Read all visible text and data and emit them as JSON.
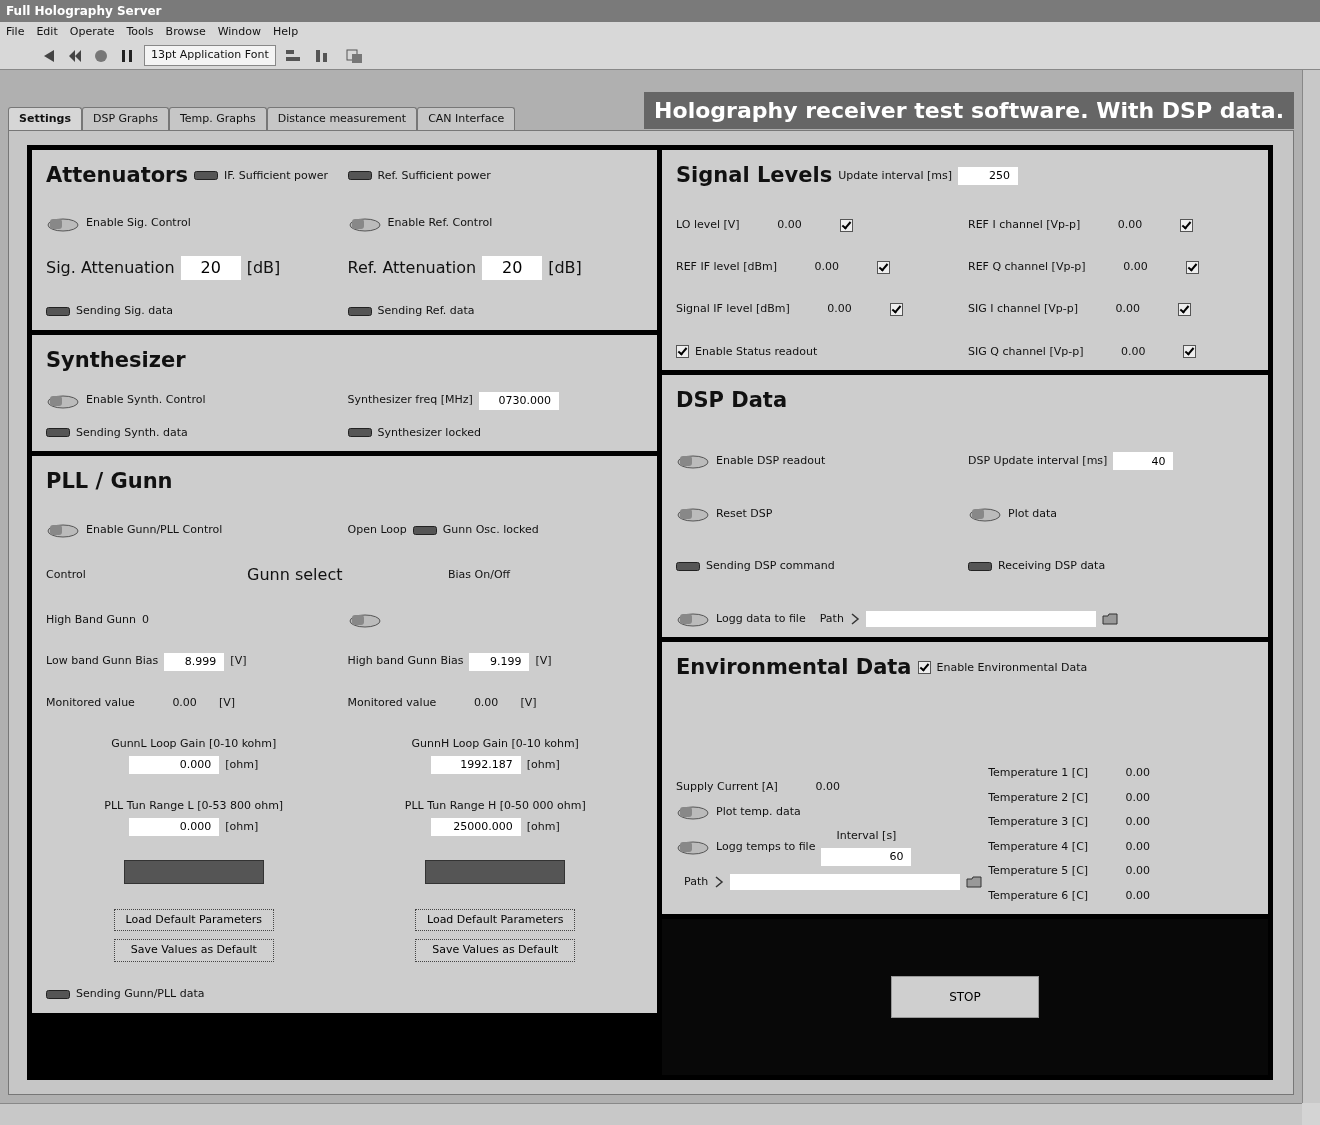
{
  "window": {
    "title": "Full Holography Server"
  },
  "menu": [
    "File",
    "Edit",
    "Operate",
    "Tools",
    "Browse",
    "Window",
    "Help"
  ],
  "toolbar": {
    "font": "13pt Application Font"
  },
  "tabs": [
    {
      "label": "Settings",
      "selected": true
    },
    {
      "label": "DSP Graphs",
      "selected": false
    },
    {
      "label": "Temp. Graphs",
      "selected": false
    },
    {
      "label": "Distance measurement",
      "selected": false
    },
    {
      "label": "CAN Interface",
      "selected": false
    }
  ],
  "banner": "Holography receiver test software. With DSP data.",
  "left_panels": [
    {
      "rows": [
        [
          [
            [
              {
                "kind": "heading",
                "label": "Attenuators"
              },
              {
                "kind": "led",
                "label": "IF. Sufficient power",
                "on": false
              }
            ]
          ],
          [
            [
              {
                "kind": "led",
                "label": "Ref. Sufficient power",
                "on": false
              }
            ]
          ]
        ],
        [
          [
            [
              {
                "kind": "toggle",
                "label": "Enable Sig. Control",
                "on": false
              }
            ]
          ],
          [
            [
              {
                "kind": "toggle",
                "label": "Enable Ref. Control",
                "on": false
              }
            ]
          ]
        ],
        [
          [
            [
              {
                "kind": "bigfield",
                "label": "Sig. Attenuation",
                "value": "20",
                "unit": "[dB]"
              }
            ]
          ],
          [
            [
              {
                "kind": "bigfield",
                "label": "Ref. Attenuation",
                "value": "20",
                "unit": "[dB]"
              }
            ]
          ]
        ],
        [
          [
            [
              {
                "kind": "led",
                "label": "Sending Sig. data",
                "on": false
              }
            ]
          ],
          [
            [
              {
                "kind": "led",
                "label": "Sending Ref. data",
                "on": false
              }
            ]
          ]
        ]
      ]
    },
    {
      "rows": [
        [
          [
            [
              {
                "kind": "heading",
                "label": "Synthesizer"
              }
            ]
          ]
        ],
        [
          [
            [
              {
                "kind": "toggle",
                "label": "Enable Synth. Control",
                "on": false
              }
            ]
          ],
          [
            [
              {
                "kind": "field",
                "label": "Synthesizer freq [MHz]",
                "value": "0730.000"
              }
            ]
          ]
        ],
        [
          [
            [
              {
                "kind": "led",
                "label": "Sending Synth. data",
                "on": false
              }
            ]
          ],
          [
            [
              {
                "kind": "led",
                "label": "Synthesizer locked",
                "on": false
              }
            ]
          ]
        ]
      ]
    },
    {
      "rows": [
        [
          [
            [
              {
                "kind": "heading",
                "label": "PLL / Gunn"
              }
            ]
          ]
        ],
        [
          [
            [
              {
                "kind": "toggle",
                "label": "Enable Gunn/PLL Control",
                "on": false
              }
            ]
          ],
          [
            [
              {
                "kind": "text",
                "label": "Open Loop"
              },
              {
                "kind": "led",
                "label": "Gunn Osc. locked",
                "on": false
              }
            ]
          ]
        ],
        [
          [
            [
              {
                "kind": "text",
                "label": "Control"
              }
            ]
          ],
          [
            [
              {
                "kind": "bigtext",
                "label": "Gunn select"
              }
            ]
          ],
          [
            [
              {
                "kind": "text",
                "label": "Bias On/Off"
              }
            ]
          ]
        ],
        [
          [
            [
              {
                "kind": "text",
                "label": "High Band Gunn"
              },
              {
                "kind": "text",
                "label": "0"
              }
            ]
          ],
          [
            [
              {
                "kind": "toggle",
                "on": false
              }
            ]
          ]
        ],
        [
          [
            [
              {
                "kind": "field",
                "label": "Low band Gunn Bias",
                "value": "8.999",
                "unit": "[V]"
              }
            ]
          ],
          [
            [
              {
                "kind": "field",
                "label": "High band Gunn Bias",
                "value": "9.199",
                "unit": "[V]"
              }
            ]
          ]
        ],
        [
          [
            [
              {
                "kind": "indicator",
                "label": "Monitored value",
                "value": "0.00",
                "unit": "[V]"
              }
            ]
          ],
          [
            [
              {
                "kind": "indicator",
                "label": "Monitored value",
                "value": "0.00",
                "unit": "[V]"
              }
            ]
          ]
        ],
        [
          [
            [
              {
                "kind": "stacked",
                "label": "GunnL Loop Gain [0-10 kohm]",
                "value": "0.000",
                "unit": "[ohm]"
              }
            ]
          ],
          [
            [
              {
                "kind": "stacked",
                "label": "GunnH Loop Gain [0-10 kohm]",
                "value": "1992.187",
                "unit": "[ohm]"
              }
            ]
          ]
        ],
        [
          [
            [
              {
                "kind": "stacked",
                "label": "PLL Tun Range L [0-53 800 ohm]",
                "value": "0.000",
                "unit": "[ohm]"
              }
            ]
          ],
          [
            [
              {
                "kind": "stacked",
                "label": "PLL Tun Range H [0-50 000 ohm]",
                "value": "25000.000",
                "unit": "[ohm]"
              }
            ]
          ]
        ],
        [
          [
            [
              {
                "kind": "bar"
              }
            ]
          ],
          [
            [
              {
                "kind": "bar"
              }
            ]
          ]
        ],
        [
          [
            [
              {
                "kind": "button",
                "label": "Load Default Parameters"
              }
            ],
            [
              {
                "kind": "button",
                "label": "Save Values as Default"
              }
            ]
          ],
          [
            [
              {
                "kind": "button",
                "label": "Load Default Parameters"
              }
            ],
            [
              {
                "kind": "button",
                "label": "Save Values as Default"
              }
            ]
          ]
        ],
        [
          [
            [
              {
                "kind": "led",
                "label": "Sending Gunn/PLL data",
                "on": false
              }
            ]
          ]
        ]
      ]
    }
  ],
  "right_panels": [
    {
      "rows": [
        [
          [
            [
              {
                "kind": "heading",
                "label": "Signal Levels"
              },
              {
                "kind": "field",
                "label": "Update interval [ms]",
                "value": "250"
              }
            ]
          ]
        ],
        [
          [
            [
              {
                "kind": "indcheck",
                "label": "LO level [V]",
                "value": "0.00",
                "checked": true
              }
            ]
          ],
          [
            [
              {
                "kind": "indcheck",
                "label": "REF I channel [Vp-p]",
                "value": "0.00",
                "checked": true
              }
            ]
          ]
        ],
        [
          [
            [
              {
                "kind": "indcheck",
                "label": "REF IF level [dBm]",
                "value": "0.00",
                "checked": true
              }
            ]
          ],
          [
            [
              {
                "kind": "indcheck",
                "label": "REF Q channel [Vp-p]",
                "value": "0.00",
                "checked": true
              }
            ]
          ]
        ],
        [
          [
            [
              {
                "kind": "indcheck",
                "label": "Signal IF level [dBm]",
                "value": "0.00",
                "checked": true
              }
            ]
          ],
          [
            [
              {
                "kind": "indcheck",
                "label": "SIG I channel [Vp-p]",
                "value": "0.00",
                "checked": true
              }
            ]
          ]
        ],
        [
          [
            [
              {
                "kind": "check",
                "label": "Enable Status readout",
                "checked": true
              }
            ]
          ],
          [
            [
              {
                "kind": "indcheck",
                "label": "SIG Q channel [Vp-p]",
                "value": "0.00",
                "checked": true
              }
            ]
          ]
        ]
      ]
    },
    {
      "rows": [
        [
          [
            [
              {
                "kind": "heading",
                "label": "DSP Data"
              }
            ]
          ]
        ],
        [
          [
            [
              {
                "kind": "toggle",
                "label": "Enable DSP readout",
                "on": false
              }
            ]
          ],
          [
            [
              {
                "kind": "field",
                "label": "DSP Update interval [ms]",
                "value": "40"
              }
            ]
          ]
        ],
        [
          [
            [
              {
                "kind": "toggle",
                "label": "Reset DSP",
                "on": false
              }
            ]
          ],
          [
            [
              {
                "kind": "toggle",
                "label": "Plot data",
                "on": false
              }
            ]
          ]
        ],
        [
          [
            [
              {
                "kind": "led",
                "label": "Sending DSP command",
                "on": false
              }
            ]
          ],
          [
            [
              {
                "kind": "led",
                "label": "Receiving DSP data",
                "on": false
              }
            ]
          ]
        ],
        [
          [
            [
              {
                "kind": "toggle",
                "label": "Logg data to file",
                "on": false
              },
              {
                "kind": "path",
                "label": "Path"
              }
            ]
          ]
        ]
      ]
    },
    {
      "rows": [
        [
          [
            [
              {
                "kind": "heading",
                "label": "Environmental Data"
              },
              {
                "kind": "check",
                "label": "Enable Environmental Data",
                "checked": true
              }
            ]
          ]
        ],
        [
          [
            [
              {
                "kind": "indicator",
                "label": "Supply Current [A]",
                "value": "0.00"
              }
            ],
            [
              {
                "kind": "toggle",
                "label": "Plot temp. data",
                "on": false
              }
            ],
            [
              {
                "kind": "toggle",
                "label": "Logg temps to file",
                "on": false
              },
              {
                "kind": "stacked",
                "label": "Interval [s]",
                "value": "60"
              }
            ],
            [
              {
                "kind": "path",
                "label": "Path"
              }
            ]
          ],
          [
            [
              {
                "kind": "indicator",
                "label": "Temperature 1 [C]",
                "value": "0.00"
              }
            ],
            [
              {
                "kind": "indicator",
                "label": "Temperature 2 [C]",
                "value": "0.00"
              }
            ],
            [
              {
                "kind": "indicator",
                "label": "Temperature 3 [C]",
                "value": "0.00"
              }
            ],
            [
              {
                "kind": "indicator",
                "label": "Temperature 4 [C]",
                "value": "0.00"
              }
            ],
            [
              {
                "kind": "indicator",
                "label": "Temperature 5 [C]",
                "value": "0.00"
              }
            ],
            [
              {
                "kind": "indicator",
                "label": "Temperature 6 [C]",
                "value": "0.00"
              }
            ]
          ]
        ]
      ]
    }
  ],
  "stop_button": "STOP"
}
